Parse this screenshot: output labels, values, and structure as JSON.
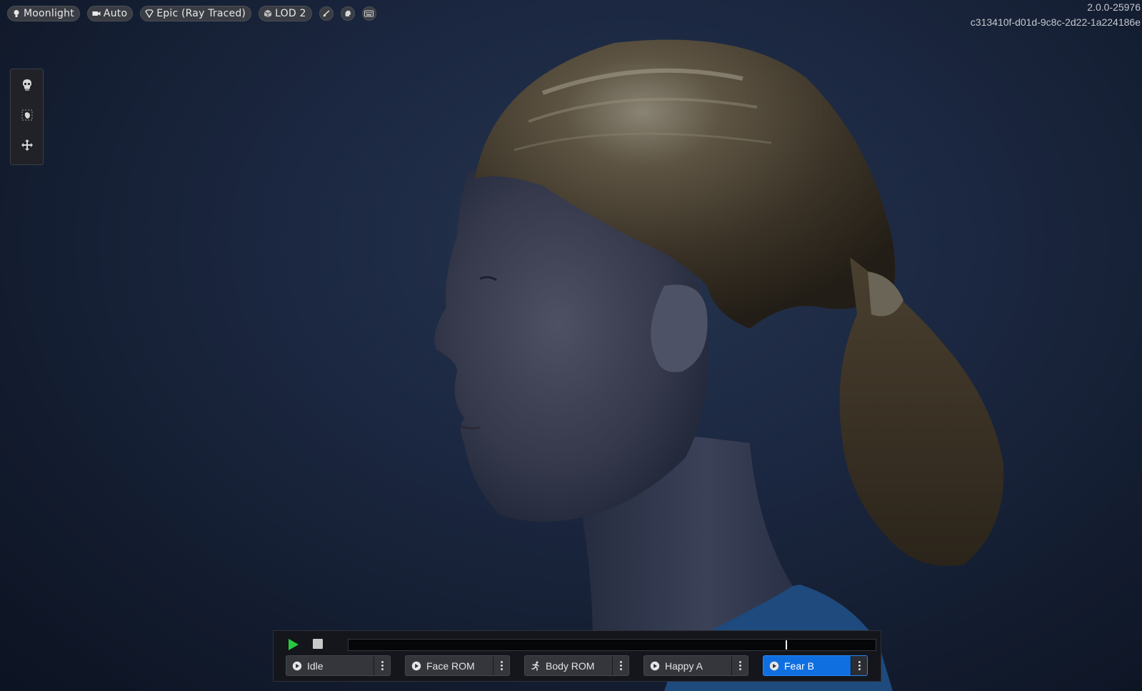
{
  "toolbar": {
    "lighting_label": "Moonlight",
    "camera_label": "Auto",
    "quality_label": "Epic (Ray Traced)",
    "lod_label": "LOD 2",
    "icons": [
      "lightbulb-icon",
      "camera-icon",
      "quality-diamond-icon",
      "cube-icon",
      "hair-icon",
      "head-icon",
      "keyboard-icon"
    ]
  },
  "version": {
    "line1": "2.0.0-25976",
    "line2": "c313410f-d01d-9c8c-2d22-1a224186e"
  },
  "left_tools": {
    "items": [
      "skeleton-icon",
      "select-object-icon",
      "move-icon"
    ]
  },
  "animation": {
    "playhead_fraction": 0.829,
    "clips": [
      {
        "label": "Idle",
        "icon": "play-circle-icon",
        "active": false
      },
      {
        "label": "Face ROM",
        "icon": "play-circle-icon",
        "active": false
      },
      {
        "label": "Body ROM",
        "icon": "running-figure-icon",
        "active": false
      },
      {
        "label": "Happy A",
        "icon": "play-circle-icon",
        "active": false
      },
      {
        "label": "Fear B",
        "icon": "play-circle-icon",
        "active": true
      }
    ],
    "colors": {
      "play": "#27c93f",
      "active_clip": "#0f6fe0"
    }
  }
}
